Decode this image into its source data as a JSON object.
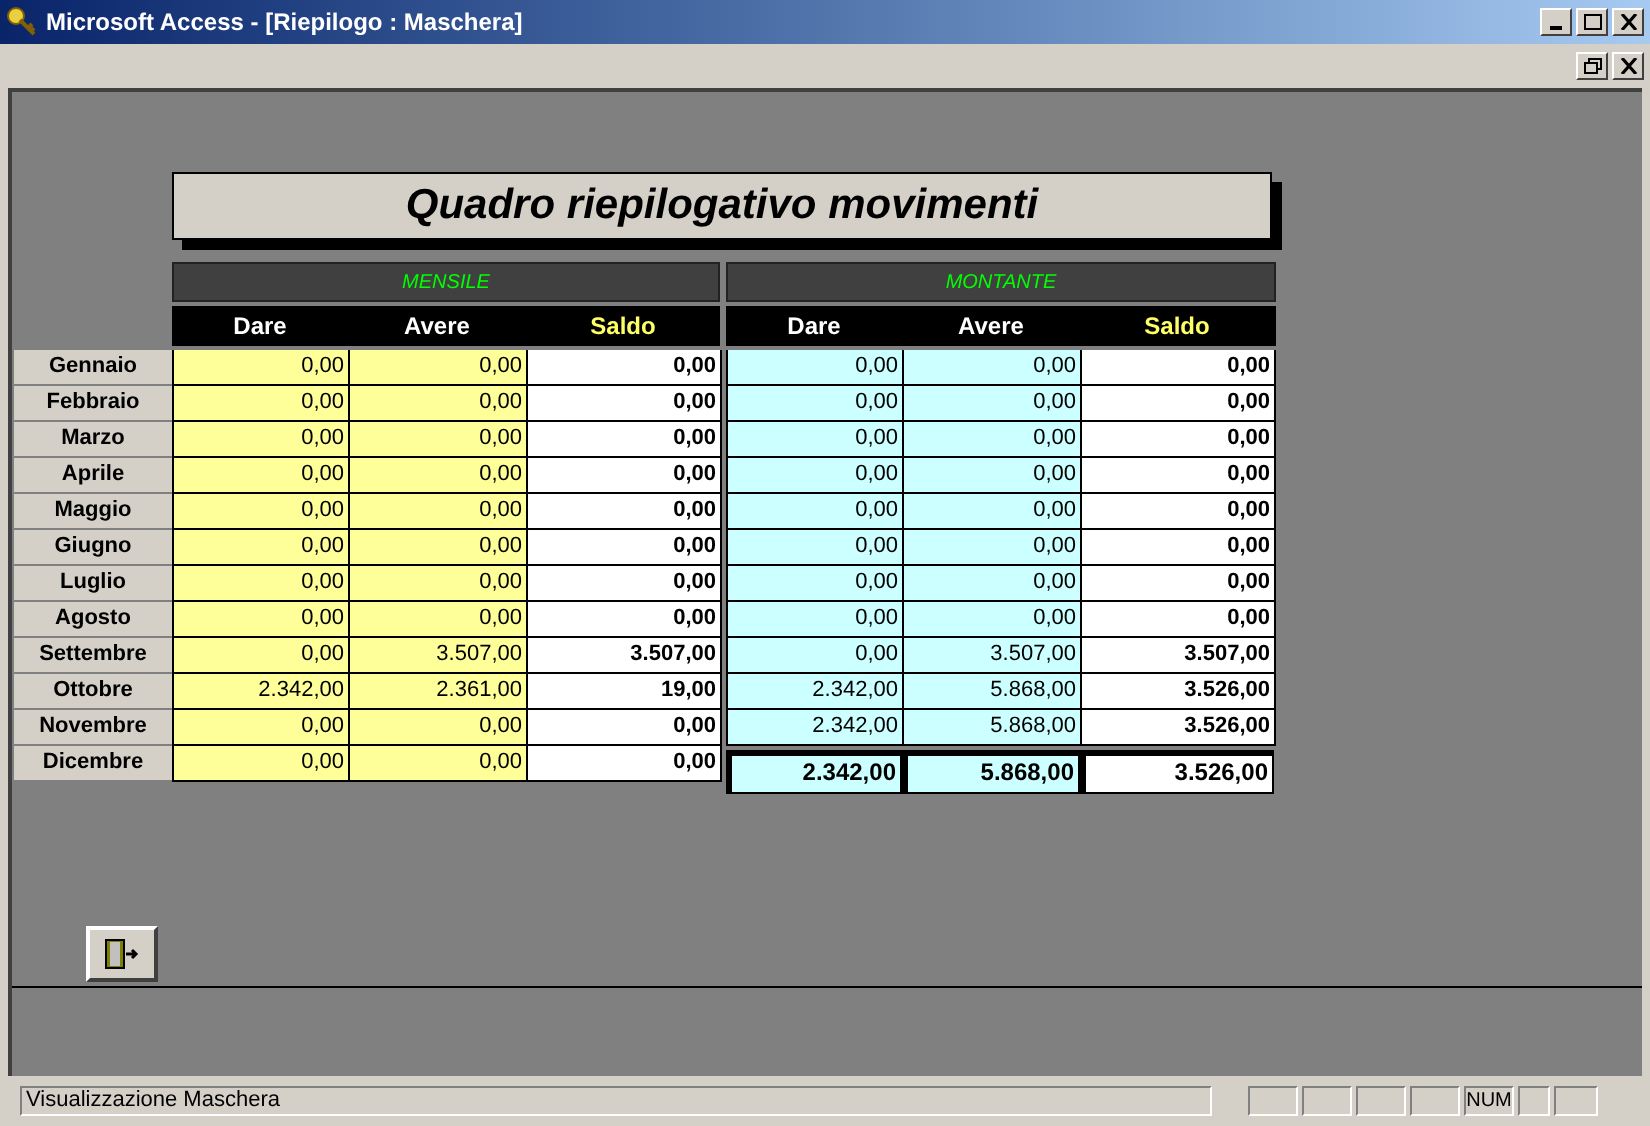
{
  "window": {
    "title": "Microsoft Access - [Riepilogo : Maschera]"
  },
  "form": {
    "title": "Quadro riepilogativo movimenti",
    "groups": [
      "MENSILE",
      "MONTANTE"
    ],
    "columns": [
      {
        "label": "Dare",
        "kind": "normal"
      },
      {
        "label": "Avere",
        "kind": "normal"
      },
      {
        "label": "Saldo",
        "kind": "balance"
      },
      {
        "label": "Dare",
        "kind": "normal"
      },
      {
        "label": "Avere",
        "kind": "normal"
      },
      {
        "label": "Saldo",
        "kind": "balance"
      }
    ],
    "rows": [
      {
        "month": "Gennaio",
        "kind": "month",
        "mensile": [
          "0,00",
          "0,00",
          "0,00"
        ],
        "montante": [
          "0,00",
          "0,00",
          "0,00"
        ]
      },
      {
        "month": "Febbraio",
        "kind": "month",
        "mensile": [
          "0,00",
          "0,00",
          "0,00"
        ],
        "montante": [
          "0,00",
          "0,00",
          "0,00"
        ]
      },
      {
        "month": "Marzo",
        "kind": "month",
        "mensile": [
          "0,00",
          "0,00",
          "0,00"
        ],
        "montante": [
          "0,00",
          "0,00",
          "0,00"
        ]
      },
      {
        "month": "Aprile",
        "kind": "month",
        "mensile": [
          "0,00",
          "0,00",
          "0,00"
        ],
        "montante": [
          "0,00",
          "0,00",
          "0,00"
        ]
      },
      {
        "month": "Maggio",
        "kind": "month",
        "mensile": [
          "0,00",
          "0,00",
          "0,00"
        ],
        "montante": [
          "0,00",
          "0,00",
          "0,00"
        ]
      },
      {
        "month": "Giugno",
        "kind": "month",
        "mensile": [
          "0,00",
          "0,00",
          "0,00"
        ],
        "montante": [
          "0,00",
          "0,00",
          "0,00"
        ]
      },
      {
        "month": "Luglio",
        "kind": "month",
        "mensile": [
          "0,00",
          "0,00",
          "0,00"
        ],
        "montante": [
          "0,00",
          "0,00",
          "0,00"
        ]
      },
      {
        "month": "Agosto",
        "kind": "month",
        "mensile": [
          "0,00",
          "0,00",
          "0,00"
        ],
        "montante": [
          "0,00",
          "0,00",
          "0,00"
        ]
      },
      {
        "month": "Settembre",
        "kind": "month",
        "mensile": [
          "0,00",
          "3.507,00",
          "3.507,00"
        ],
        "montante": [
          "0,00",
          "3.507,00",
          "3.507,00"
        ]
      },
      {
        "month": "Ottobre",
        "kind": "month",
        "mensile": [
          "2.342,00",
          "2.361,00",
          "19,00"
        ],
        "montante": [
          "2.342,00",
          "5.868,00",
          "3.526,00"
        ]
      },
      {
        "month": "Novembre",
        "kind": "month",
        "mensile": [
          "0,00",
          "0,00",
          "0,00"
        ],
        "montante": [
          "2.342,00",
          "5.868,00",
          "3.526,00"
        ]
      },
      {
        "month": "Dicembre",
        "kind": "total",
        "mensile": [
          "0,00",
          "0,00",
          "0,00"
        ],
        "montante": [
          "2.342,00",
          "5.868,00",
          "3.526,00"
        ]
      }
    ]
  },
  "status_bar": {
    "message": "Visualizzazione Maschera",
    "indicator": "NUM"
  }
}
